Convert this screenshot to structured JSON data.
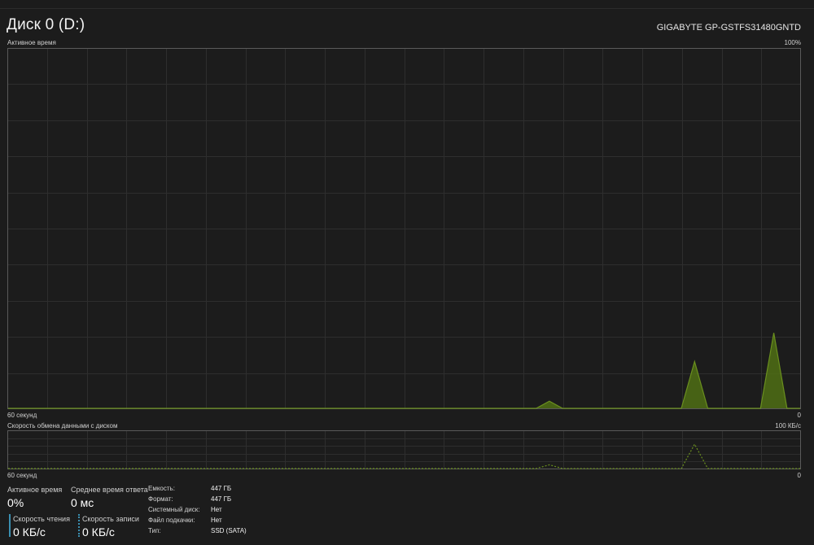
{
  "header": {
    "title": "Диск 0 (D:)",
    "model": "GIGABYTE GP-GSTFS31480GNTD"
  },
  "active_chart": {
    "label": "Активное время",
    "max_label": "100%",
    "x_left_label": "60 секунд",
    "x_right_label": "0"
  },
  "transfer_chart": {
    "label": "Скорость обмена данными с диском",
    "max_label": "100 КБ/с",
    "x_left_label": "60 секунд",
    "x_right_label": "0"
  },
  "stats": {
    "active_time_label": "Активное время",
    "active_time_value": "0%",
    "avg_response_label": "Среднее время ответа",
    "avg_response_value": "0 мс",
    "read_speed_label": "Скорость чтения",
    "read_speed_value": "0 КБ/с",
    "write_speed_label": "Скорость записи",
    "write_speed_value": "0 КБ/с"
  },
  "properties": [
    {
      "label": "Емкость:",
      "value": "447 ГБ"
    },
    {
      "label": "Формат:",
      "value": "447 ГБ"
    },
    {
      "label": "Системный диск:",
      "value": "Нет"
    },
    {
      "label": "Файл подкачки:",
      "value": "Нет"
    },
    {
      "label": "Тип:",
      "value": "SSD (SATA)"
    }
  ],
  "colors": {
    "accent_line": "#6a8f1e",
    "accent_fill": "#4f6e14",
    "read_bar": "#3a8fb0",
    "write_bar": "#3a8fb0"
  },
  "chart_data": [
    {
      "type": "area",
      "title": "Активное время",
      "ylim": [
        0,
        100
      ],
      "xlim": [
        60,
        0
      ],
      "xlabel": "60 секунд",
      "grid": true,
      "series": [
        {
          "x": [
            60,
            59,
            58,
            57,
            56,
            55,
            54,
            53,
            52,
            51,
            50,
            49,
            48,
            47,
            46,
            45,
            44,
            43,
            42,
            41,
            40,
            39,
            38,
            37,
            36,
            35,
            34,
            33,
            32,
            31,
            30,
            29,
            28,
            27,
            26,
            25,
            24,
            23,
            22,
            21,
            20,
            19,
            18,
            17,
            16,
            15,
            14,
            13,
            12,
            11,
            10,
            9,
            8,
            7,
            6,
            5,
            4,
            3,
            2,
            1,
            0
          ],
          "values": [
            0,
            0,
            0,
            0,
            0,
            0,
            0,
            0,
            0,
            0,
            0,
            0,
            0,
            0,
            0,
            0,
            0,
            0,
            0,
            0,
            0,
            0,
            0,
            0,
            0,
            0,
            0,
            0,
            0,
            0,
            0,
            0,
            0,
            0,
            0,
            0,
            0,
            0,
            0,
            0,
            0,
            2,
            0,
            0,
            0,
            0,
            0,
            0,
            0,
            0,
            0,
            0,
            13,
            0,
            0,
            0,
            0,
            0,
            21,
            0,
            0
          ]
        }
      ]
    },
    {
      "type": "line",
      "title": "Скорость обмена данными с диском",
      "ylim": [
        0,
        100
      ],
      "xlim": [
        60,
        0
      ],
      "xlabel": "60 секунд",
      "grid": true,
      "series": [
        {
          "x": [
            60,
            59,
            58,
            57,
            56,
            55,
            54,
            53,
            52,
            51,
            50,
            49,
            48,
            47,
            46,
            45,
            44,
            43,
            42,
            41,
            40,
            39,
            38,
            37,
            36,
            35,
            34,
            33,
            32,
            31,
            30,
            29,
            28,
            27,
            26,
            25,
            24,
            23,
            22,
            21,
            20,
            19,
            18,
            17,
            16,
            15,
            14,
            13,
            12,
            11,
            10,
            9,
            8,
            7,
            6,
            5,
            4,
            3,
            2,
            1,
            0
          ],
          "values": [
            0,
            0,
            0,
            0,
            0,
            0,
            0,
            0,
            0,
            0,
            0,
            0,
            0,
            0,
            0,
            0,
            0,
            0,
            0,
            0,
            0,
            0,
            0,
            0,
            0,
            0,
            0,
            0,
            0,
            0,
            0,
            0,
            0,
            0,
            0,
            0,
            0,
            0,
            0,
            0,
            0,
            10,
            0,
            0,
            0,
            0,
            0,
            0,
            0,
            0,
            0,
            0,
            65,
            0,
            0,
            0,
            0,
            0,
            0,
            0,
            0
          ]
        }
      ]
    }
  ]
}
